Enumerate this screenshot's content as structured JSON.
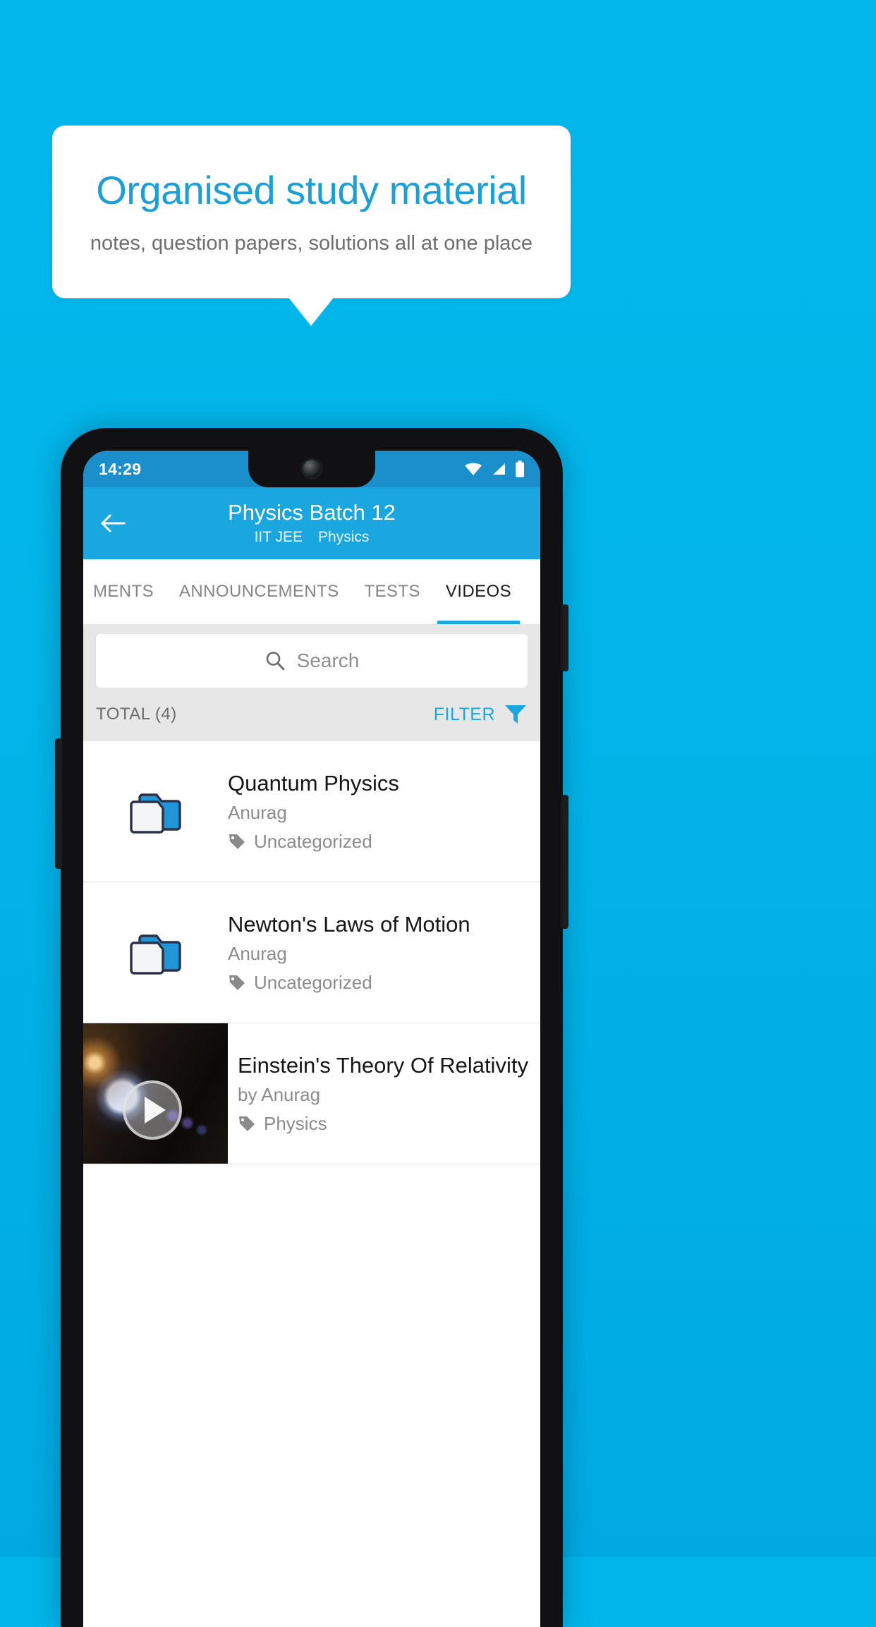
{
  "promo": {
    "title": "Organised study material",
    "subtitle": "notes, question papers, solutions all at one place",
    "accent_color": "#1b9fd8",
    "background_color": "#02b4e9"
  },
  "phone": {
    "statusbar": {
      "time": "14:29",
      "icons": [
        "wifi-icon",
        "signal-icon",
        "battery-icon"
      ]
    },
    "appbar": {
      "back_icon": "back-arrow-icon",
      "title": "Physics Batch 12",
      "subtitle_exam": "IIT JEE",
      "subtitle_subject": "Physics",
      "color": "#1aa7e0"
    },
    "tabs": [
      {
        "label": "MENTS",
        "active": false
      },
      {
        "label": "ANNOUNCEMENTS",
        "active": false
      },
      {
        "label": "TESTS",
        "active": false
      },
      {
        "label": "VIDEOS",
        "active": true
      }
    ],
    "search": {
      "placeholder": "Search",
      "icon": "search-icon"
    },
    "toolbar": {
      "total_label": "TOTAL (4)",
      "filter_label": "FILTER",
      "filter_icon": "filter-funnel-icon",
      "filter_color": "#1aa7e0"
    },
    "list": [
      {
        "type": "folder",
        "icon": "folder-icon",
        "title": "Quantum Physics",
        "author": "Anurag",
        "tag_icon": "tag-icon",
        "tag": "Uncategorized"
      },
      {
        "type": "folder",
        "icon": "folder-icon",
        "title": "Newton's Laws of Motion",
        "author": "Anurag",
        "tag_icon": "tag-icon",
        "tag": "Uncategorized"
      },
      {
        "type": "video",
        "icon": "play-icon",
        "title": "Einstein's Theory Of Relativity",
        "author": "by Anurag",
        "tag_icon": "tag-icon",
        "tag": "Physics"
      }
    ]
  }
}
